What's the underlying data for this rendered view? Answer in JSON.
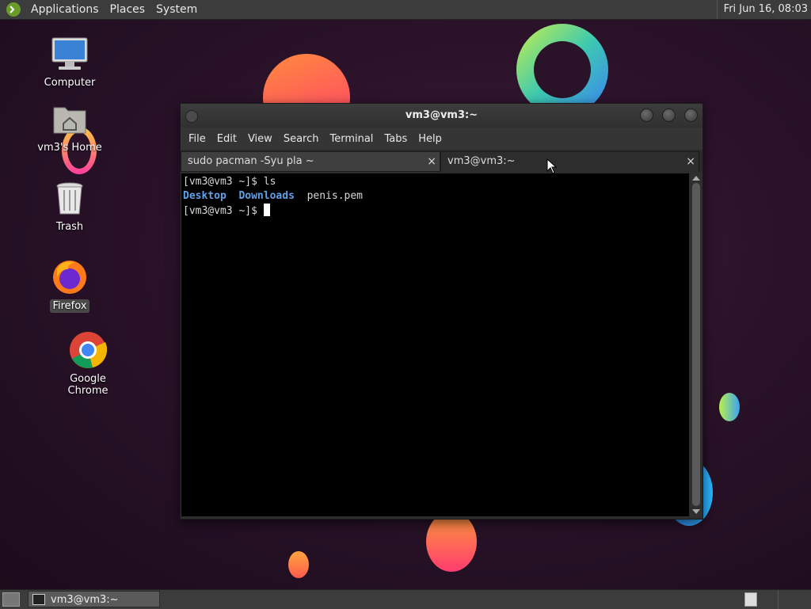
{
  "top_panel": {
    "menus": [
      "Applications",
      "Places",
      "System"
    ],
    "clock": "Fri Jun 16, 08:03"
  },
  "desktop": {
    "icons": [
      {
        "label": "Computer",
        "icon": "computer-icon"
      },
      {
        "label": "vm3's Home",
        "icon": "home-folder-icon"
      },
      {
        "label": "Trash",
        "icon": "trash-icon"
      },
      {
        "label": "Firefox",
        "icon": "firefox-icon",
        "selected": true
      },
      {
        "label": "Google Chrome",
        "icon": "chrome-icon"
      }
    ]
  },
  "terminal_window": {
    "title": "vm3@vm3:~",
    "menu": [
      "File",
      "Edit",
      "View",
      "Search",
      "Terminal",
      "Tabs",
      "Help"
    ],
    "tabs": [
      {
        "label": "sudo pacman -Syu pla ~",
        "active": false
      },
      {
        "label": "vm3@vm3:~",
        "active": true
      }
    ],
    "close_glyph": "×",
    "lines": {
      "prompt1": "[vm3@vm3 ~]$ ",
      "command1": "ls",
      "dir1": "Desktop",
      "dir2": "Downloads",
      "file1": "penis.pem",
      "prompt2": "[vm3@vm3 ~]$ "
    }
  },
  "bottom_panel": {
    "task": "vm3@vm3:~"
  },
  "colors": {
    "panel": "#3c3c3c",
    "terminal_bg": "#000000",
    "directory": "#5fa0e8"
  }
}
